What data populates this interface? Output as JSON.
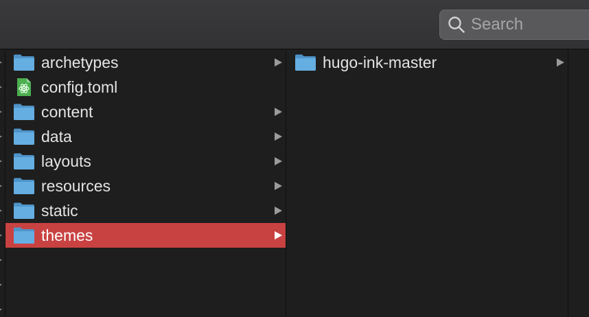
{
  "search": {
    "placeholder": "Search"
  },
  "columns": {
    "main": {
      "items": [
        {
          "label": "archetypes",
          "kind": "folder",
          "has_children": true
        },
        {
          "label": "config.toml",
          "kind": "file",
          "has_children": false
        },
        {
          "label": "content",
          "kind": "folder",
          "has_children": true
        },
        {
          "label": "data",
          "kind": "folder",
          "has_children": true
        },
        {
          "label": "layouts",
          "kind": "folder",
          "has_children": true
        },
        {
          "label": "resources",
          "kind": "folder",
          "has_children": true
        },
        {
          "label": "static",
          "kind": "folder",
          "has_children": true
        },
        {
          "label": "themes",
          "kind": "folder",
          "has_children": true,
          "selected": true
        }
      ]
    },
    "second": {
      "items": [
        {
          "label": "hugo-ink-master",
          "kind": "folder",
          "has_children": true
        }
      ]
    }
  },
  "icons": {
    "folder": "folder-icon",
    "file": "atom-file-icon",
    "search": "search-icon",
    "disclosure": "chevron-right-icon"
  },
  "colors": {
    "selection": "#c94242",
    "folder": "#5fa8dc",
    "file_icon": "#4caf50",
    "text": "#e4e4e4",
    "background": "#1e1e1e"
  }
}
